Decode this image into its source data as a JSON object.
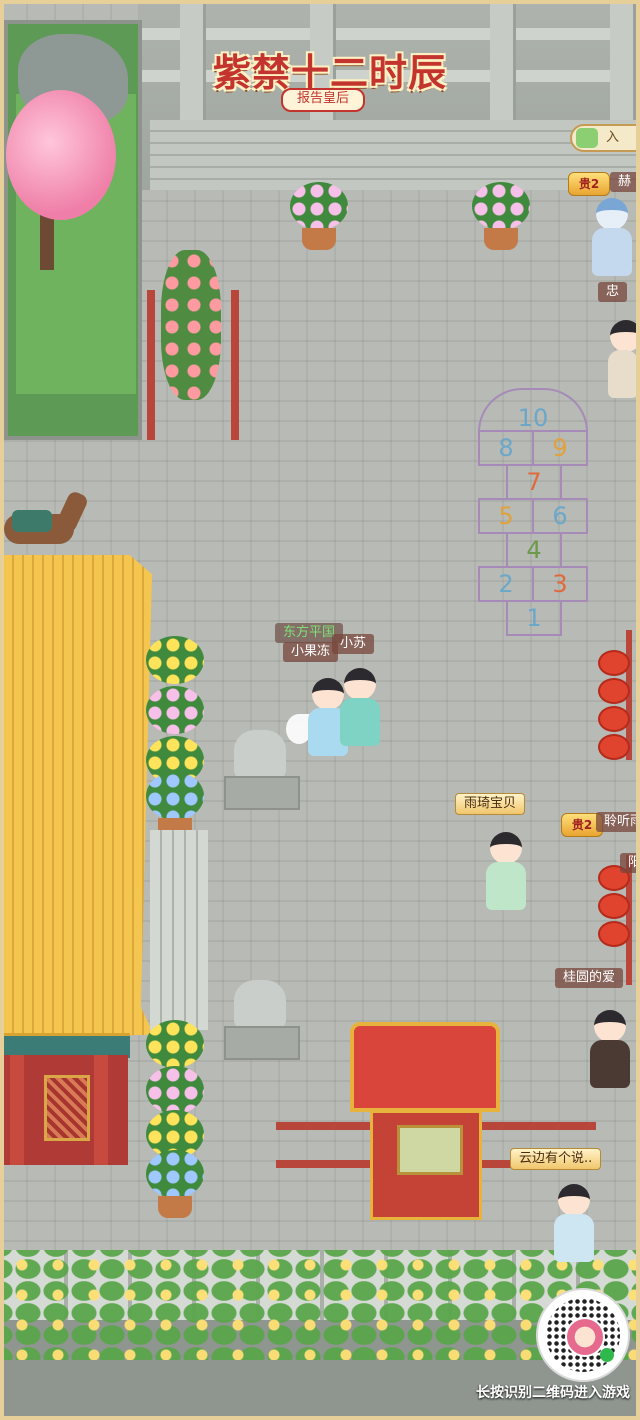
{
  "logo": {
    "title": "紫禁十二时辰",
    "subtitle": "报告皇后"
  },
  "top_right_button": {
    "icon": "tea-set-icon",
    "label": "入"
  },
  "hopscotch": {
    "dome": "10",
    "rows": [
      [
        "8",
        "9"
      ],
      [
        "7"
      ],
      [
        "5",
        "6"
      ],
      [
        "4"
      ],
      [
        "2",
        "3"
      ],
      [
        "1"
      ]
    ]
  },
  "players": {
    "xiaoguodong": {
      "name": "小果冻",
      "tag": "东方平国",
      "partner": "小苏"
    },
    "yuqi": {
      "name": "雨琦宝贝"
    },
    "lingting": {
      "badge": "贵2",
      "name": "聆听雨"
    },
    "guiyuan": {
      "name": "桂圆的爱"
    },
    "yunbian": {
      "name": "云边有个说.."
    },
    "zhong": {
      "name": "忠"
    },
    "top_right": {
      "badge": "贵2",
      "name": "赫"
    },
    "right_mid": {
      "name": "阳"
    }
  },
  "cta": {
    "text": "长按识别二维码进入游戏"
  },
  "colors": {
    "frame": "#e7cf9a",
    "accent_red": "#c2342d",
    "roof_gold": "#f4c64f"
  }
}
